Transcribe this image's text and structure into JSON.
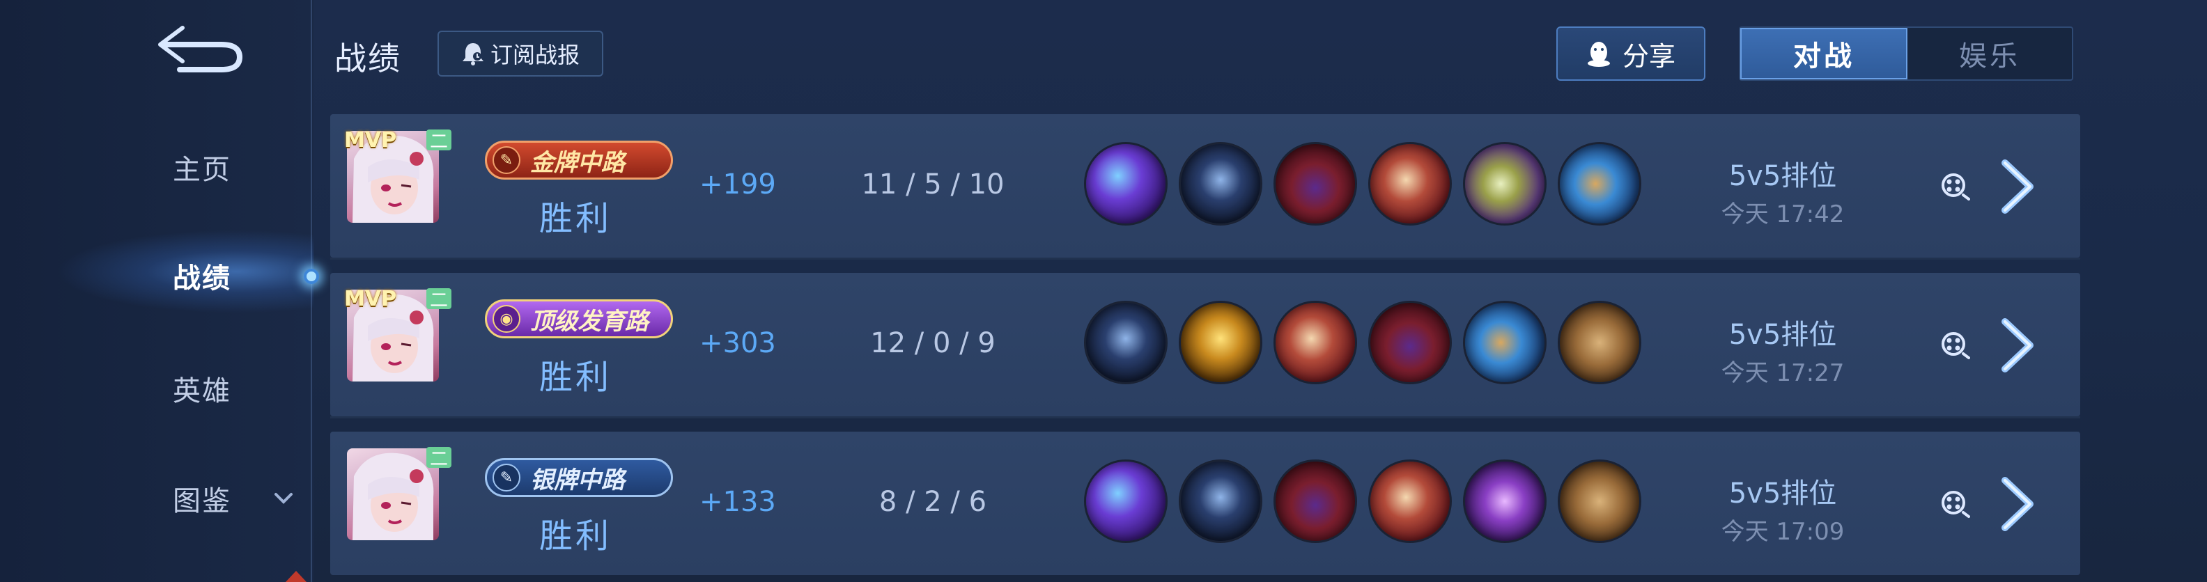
{
  "header": {
    "title": "战绩",
    "subscribe_label": "订阅战报",
    "share_label": "分享",
    "tabs": [
      {
        "label": "对战",
        "active": true
      },
      {
        "label": "娱乐",
        "active": false
      }
    ]
  },
  "sidebar": {
    "items": [
      {
        "label": "主页"
      },
      {
        "label": "战绩",
        "active": true
      },
      {
        "label": "英雄"
      },
      {
        "label": "图鉴"
      }
    ]
  },
  "matches": [
    {
      "mvp": "MVP",
      "badge": "二",
      "rank_label": "金牌中路",
      "rank_style": "gold",
      "result": "胜利",
      "score_change": "+199",
      "kda": "11  /  5  /  10",
      "items": [
        "purple-dragon-item",
        "dark-boots-item",
        "crimson-hood-item",
        "red-tome-item",
        "green-book-item",
        "blue-orb-item"
      ],
      "mode": "5v5排位",
      "time": "今天 17:42"
    },
    {
      "mvp": "MVP",
      "badge": "二",
      "rank_label": "顶级发育路",
      "rank_style": "top",
      "result": "胜利",
      "score_change": "+303",
      "kda": "12  /  0  /  9",
      "items": [
        "dark-boots-item",
        "gold-serpent-item",
        "red-tome-item",
        "crimson-hood-item",
        "blue-orb-item",
        "wooden-crate-item"
      ],
      "mode": "5v5排位",
      "time": "今天 17:27"
    },
    {
      "mvp": "",
      "badge": "二",
      "rank_label": "银牌中路",
      "rank_style": "silver",
      "result": "胜利",
      "score_change": "+133",
      "kda": "8  /  2  /  6",
      "items": [
        "purple-dragon-item",
        "dark-boots-item",
        "crimson-hood-item",
        "red-tome-item",
        "violet-staff-item",
        "wooden-crate-item"
      ],
      "mode": "5v5排位",
      "time": "今天 17:09"
    }
  ],
  "colors": {
    "win_text": "#83bdff",
    "score_text": "#5ca9f6",
    "gold_badge": "#b3321f",
    "silver_badge": "#2b4c86",
    "top_badge": "#8a3fc4",
    "active_tab": "#3d6fb4"
  }
}
